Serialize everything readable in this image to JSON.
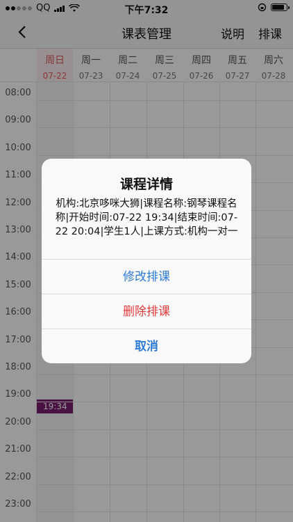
{
  "status_bar": {
    "carrier": "QQ",
    "time": "下午7:32"
  },
  "nav": {
    "title": "课表管理",
    "actions": [
      "说明",
      "排课"
    ]
  },
  "week": {
    "days": [
      {
        "name": "周日",
        "date": "07-22",
        "active": true
      },
      {
        "name": "周一",
        "date": "07-23"
      },
      {
        "name": "周二",
        "date": "07-24"
      },
      {
        "name": "周三",
        "date": "07-25"
      },
      {
        "name": "周四",
        "date": "07-26"
      },
      {
        "name": "周五",
        "date": "07-27"
      },
      {
        "name": "周六",
        "date": "07-28"
      }
    ]
  },
  "timeline": {
    "hours": [
      "08:00",
      "09:00",
      "10:00",
      "11:00",
      "12:00",
      "13:00",
      "14:00",
      "15:00",
      "16:00",
      "17:00",
      "18:00",
      "19:00",
      "20:00",
      "21:00",
      "22:00",
      "23:00"
    ]
  },
  "course_block": {
    "label": "19:34",
    "color": "#7a1f6e"
  },
  "dialog": {
    "title": "课程详情",
    "message": "机构:北京哆咪大狮|课程名称:钢琴课程名称|开始时间:07-22 19:34|结束时间:07-22 20:04|学生1人|上课方式:机构一对一",
    "edit_label": "修改排课",
    "delete_label": "删除排课",
    "cancel_label": "取消"
  },
  "colors": {
    "accent_blue": "#2e7bd8",
    "danger_red": "#e23b3b",
    "today_red": "#e05a5a"
  }
}
